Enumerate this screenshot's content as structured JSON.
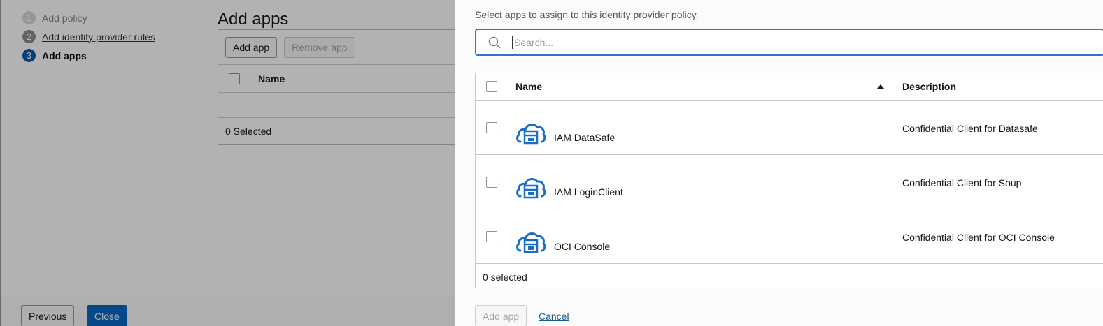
{
  "wizard": {
    "steps": [
      {
        "num": "1",
        "label": "Add policy"
      },
      {
        "num": "2",
        "label": "Add identity provider rules"
      },
      {
        "num": "3",
        "label": "Add apps"
      }
    ]
  },
  "background": {
    "title": "Add apps",
    "add_app_label": "Add app",
    "remove_app_label": "Remove app",
    "name_header": "Name",
    "selected_count": "0 Selected",
    "previous_label": "Previous",
    "close_label": "Close"
  },
  "drawer": {
    "description": "Select apps to assign to this identity provider policy.",
    "search_placeholder": "Search...",
    "columns": {
      "name": "Name",
      "description": "Description"
    },
    "apps": [
      {
        "name": "IAM DataSafe",
        "description": "Confidential Client for Datasafe",
        "icon": "cloud-app-icon"
      },
      {
        "name": "IAM LoginClient",
        "description": "Confidential Client for Soup",
        "icon": "cloud-app-icon"
      },
      {
        "name": "OCI Console",
        "description": "Confidential Client for OCI Console",
        "icon": "cloud-app-icon"
      }
    ],
    "selected_count": "0 selected",
    "add_app_label": "Add app",
    "cancel_label": "Cancel"
  },
  "colors": {
    "accent": "#0b67c4",
    "icon_blue": "#1a6fc4"
  }
}
